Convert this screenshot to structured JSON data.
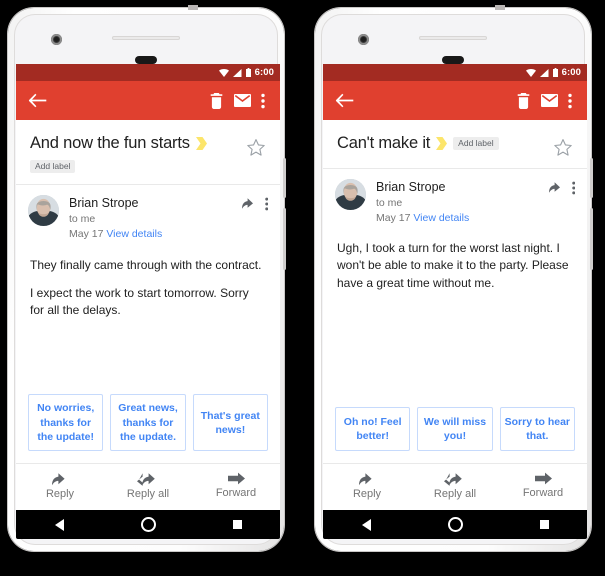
{
  "statusbar": {
    "time": "6:00",
    "icons": [
      "wifi-icon",
      "signal-icon",
      "battery-icon"
    ]
  },
  "appbar": {
    "back_label": "Back",
    "delete_label": "Delete",
    "mark_unread_label": "Mark as unread",
    "overflow_label": "More options"
  },
  "common": {
    "add_label": "Add label",
    "sender_name": "Brian Strope",
    "recipient": "to me",
    "date": "May 17",
    "view_details": "View details",
    "reply": "Reply",
    "reply_all": "Reply all",
    "forward": "Forward"
  },
  "colors": {
    "status_bar": "#a32b22",
    "app_bar": "#e0402f",
    "chip_text": "#4285f4",
    "chip_border": "#c6dafc",
    "link": "#4285f4",
    "label_yellow": "#fce56b",
    "nav_bar": "#000000"
  },
  "phones": [
    {
      "id": "phone-left",
      "subject": "And now the fun starts",
      "label_icon": "label-chevron-icon",
      "label_layout": "stacked",
      "body": [
        "They finally came through with the contract.",
        "I expect the work to start tomorrow. Sorry for all the delays."
      ],
      "smart_replies": [
        "No worries, thanks for the update!",
        "Great news, thanks for the update.",
        "That's great news!"
      ]
    },
    {
      "id": "phone-right",
      "subject": "Can't make it",
      "label_icon": "label-chevron-icon",
      "label_layout": "inline",
      "body": [
        "Ugh, I took a turn for the worst last night. I won't be able to make it to the party. Please have a great time without me."
      ],
      "smart_replies": [
        "Oh no! Feel better!",
        "We will miss you!",
        "Sorry to hear that."
      ]
    }
  ],
  "navbar": {
    "back": "back-triangle-icon",
    "home": "home-circle-icon",
    "recents": "recents-square-icon"
  }
}
